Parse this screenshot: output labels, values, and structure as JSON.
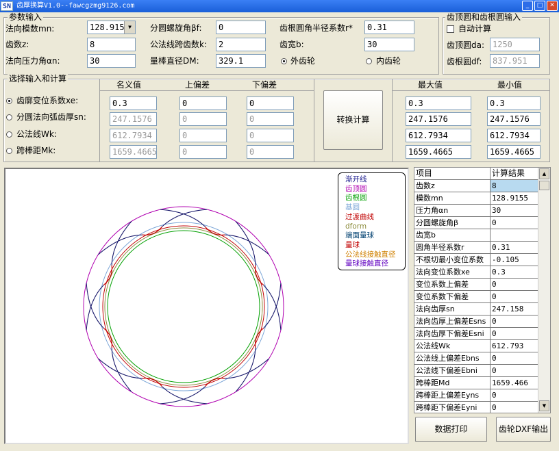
{
  "window": {
    "icon_text": "SN",
    "title": "齿厚换算V1.0--fawcgzmg9126.com"
  },
  "params": {
    "title": "参数输入",
    "mn": {
      "label": "法向模数mn:",
      "value": "128.915"
    },
    "z": {
      "label": "齿数z:",
      "value": "8"
    },
    "alpha": {
      "label": "法向压力角αn:",
      "value": "30"
    },
    "beta": {
      "label": "分圆螺旋角βf:",
      "value": "0"
    },
    "k": {
      "label": "公法线跨齿数k:",
      "value": "2"
    },
    "dm": {
      "label": "量棒直径DM:",
      "value": "329.1"
    },
    "rf": {
      "label": "齿根圆角半径系数r*",
      "value": "0.31"
    },
    "b": {
      "label": "齿宽b:",
      "value": "30"
    },
    "gear_external": "外齿轮",
    "gear_internal": "内齿轮"
  },
  "tip_root": {
    "title": "齿顶圆和齿根圆输入",
    "auto": "自动计算",
    "da_label": "齿顶圆da:",
    "da_value": "1250",
    "df_label": "齿根圆df:",
    "df_value": "837.951"
  },
  "calc": {
    "title": "选择输入和计算",
    "col_nominal": "名义值",
    "col_upper": "上偏差",
    "col_lower": "下偏差",
    "col_max": "最大值",
    "col_min": "最小值",
    "rows": [
      {
        "label": "齿廓变位系数xe:",
        "nominal": "0.3",
        "upper": "0",
        "lower": "0",
        "max": "0.3",
        "min": "0.3"
      },
      {
        "label": "分圆法向弧齿厚sn:",
        "nominal": "247.1576",
        "upper": "0",
        "lower": "0",
        "max": "247.1576",
        "min": "247.1576"
      },
      {
        "label": "公法线Wk:",
        "nominal": "612.7934",
        "upper": "0",
        "lower": "0",
        "max": "612.7934",
        "min": "612.7934"
      },
      {
        "label": "跨棒距Mk:",
        "nominal": "1659.4665",
        "upper": "0",
        "lower": "0",
        "max": "1659.4665",
        "min": "1659.4665"
      }
    ],
    "convert_button": "转换计算"
  },
  "legend": [
    {
      "text": "渐开线",
      "color": "#1a1a8c"
    },
    {
      "text": "齿顶圆",
      "color": "#b000b0"
    },
    {
      "text": "齿根圆",
      "color": "#00a000"
    },
    {
      "text": "基圆",
      "color": "#7fa8d8"
    },
    {
      "text": "过渡曲线",
      "color": "#c00000"
    },
    {
      "text": "dform",
      "color": "#8c8c3c"
    },
    {
      "text": "端面量球",
      "color": "#004070"
    },
    {
      "text": "量球",
      "color": "#c00000"
    },
    {
      "text": "公法线接触直径",
      "color": "#d08000"
    },
    {
      "text": "量球接触直径",
      "color": "#6000c0"
    }
  ],
  "grid": {
    "headers": [
      "项目",
      "计算结果"
    ],
    "rows": [
      [
        "齿数z",
        "8"
      ],
      [
        "模数mn",
        "128.9155"
      ],
      [
        "压力角αn",
        "30"
      ],
      [
        "分圆螺旋角β",
        "0"
      ],
      [
        "齿宽b",
        ""
      ],
      [
        "圆角半径系数r",
        "0.31"
      ],
      [
        "不根切最小变位系数",
        "-0.105"
      ],
      [
        "法向变位系数xe",
        "0.3"
      ],
      [
        "变位系数上偏差",
        "0"
      ],
      [
        "变位系数下偏差",
        "0"
      ],
      [
        "法向齿厚sn",
        "247.158"
      ],
      [
        "法向齿厚上偏差Esns",
        "0"
      ],
      [
        "法向齿厚下偏差Esni",
        "0"
      ],
      [
        "公法线Wk",
        "612.793"
      ],
      [
        "公法线上偏差Ebns",
        "0"
      ],
      [
        "公法线下偏差Ebni",
        "0"
      ],
      [
        "跨棒距Md",
        "1659.466"
      ],
      [
        "跨棒距上偏差Eyns",
        "0"
      ],
      [
        "跨棒距下偏差Eyni",
        "0"
      ]
    ]
  },
  "buttons": {
    "print": "数据打印",
    "dxf": "齿轮DXF输出"
  }
}
